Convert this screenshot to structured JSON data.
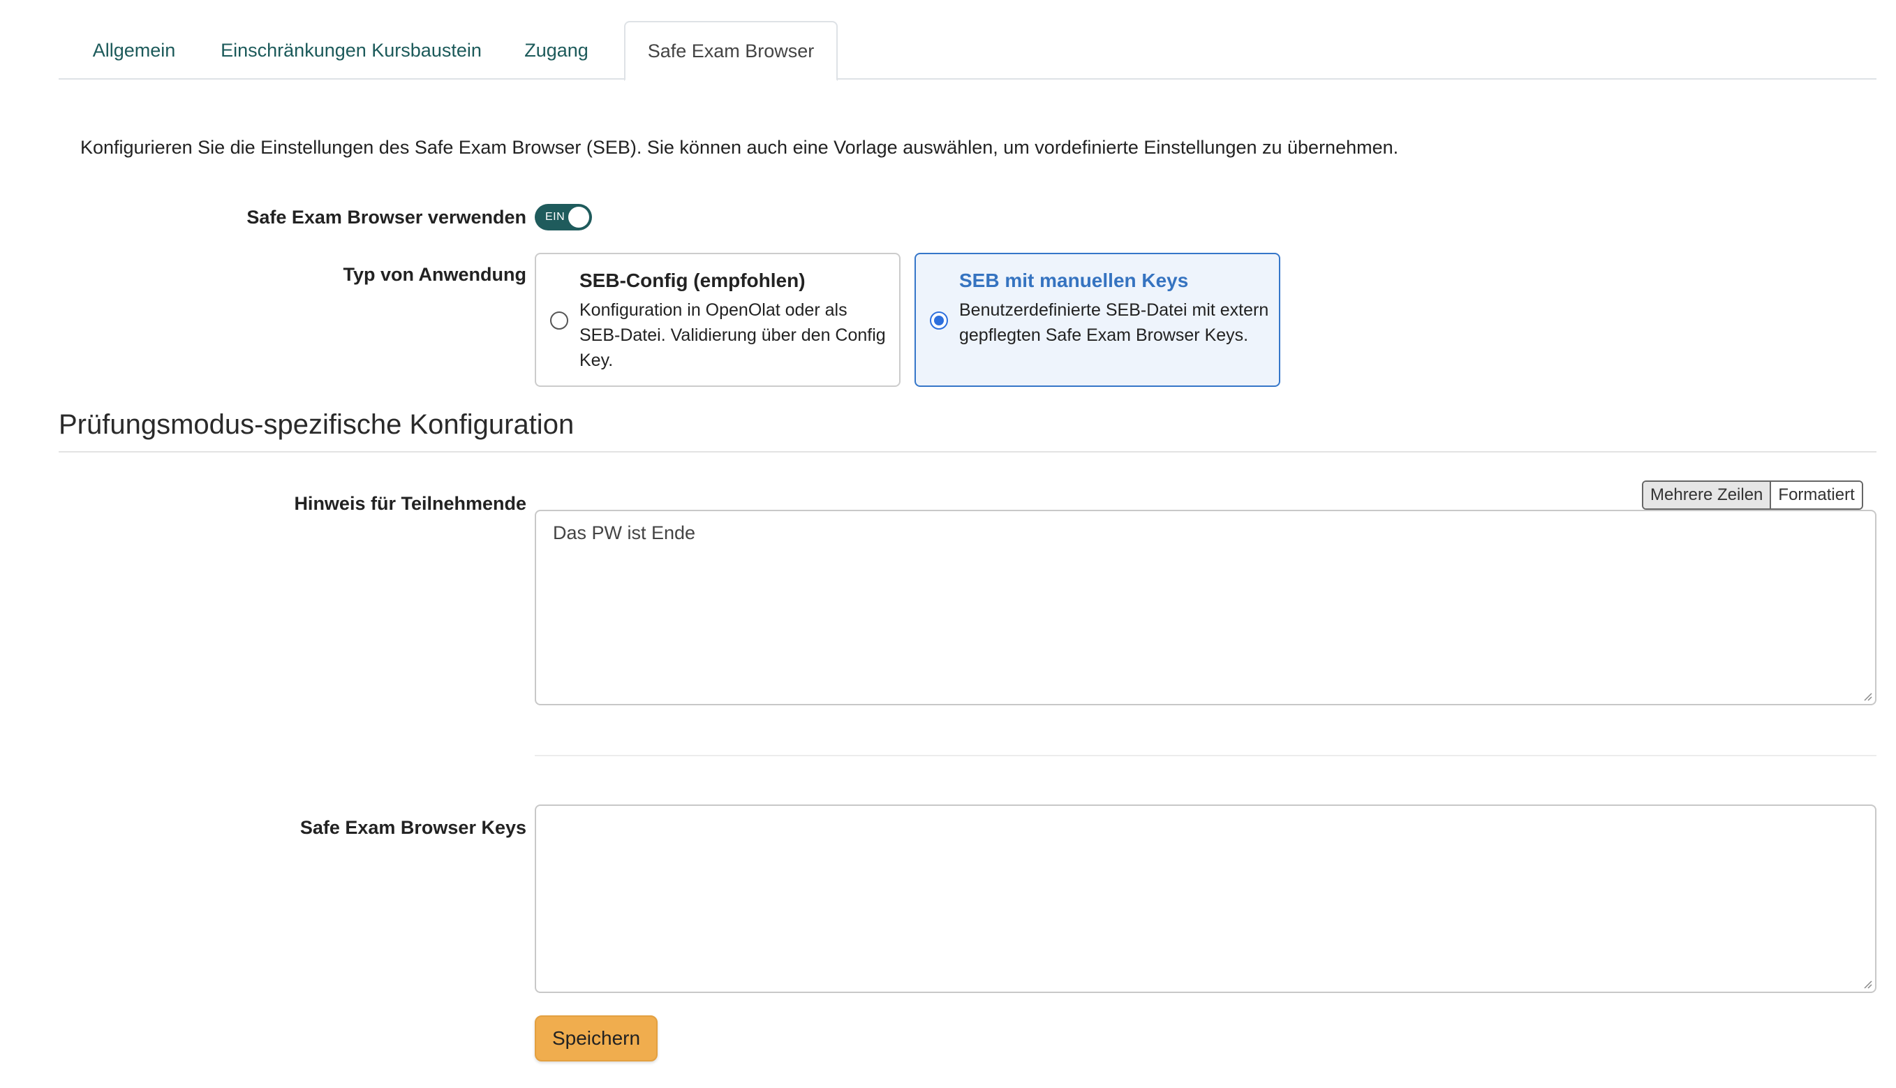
{
  "tabs": [
    {
      "label": "Allgemein",
      "active": false
    },
    {
      "label": "Einschränkungen Kursbaustein",
      "active": false
    },
    {
      "label": "Zugang",
      "active": false
    },
    {
      "label": "Safe Exam Browser",
      "active": true
    }
  ],
  "intro": "Konfigurieren Sie die Einstellungen des Safe Exam Browser (SEB). Sie können auch eine Vorlage auswählen, um vordefinierte Einstellungen zu übernehmen.",
  "use_seb": {
    "label": "Safe Exam Browser verwenden",
    "toggle_text": "EIN",
    "enabled": true
  },
  "app_type": {
    "label": "Typ von Anwendung",
    "options": [
      {
        "title": "SEB-Config (empfohlen)",
        "description": "Konfiguration in OpenOlat oder als SEB-Datei. Validierung über den Config Key.",
        "selected": false
      },
      {
        "title": "SEB mit manuellen Keys",
        "description": "Benutzerdefinierte SEB-Datei mit extern gepflegten Safe Exam Browser Keys.",
        "selected": true
      }
    ]
  },
  "section_title": "Prüfungsmodus-spezifische Konfiguration",
  "hint": {
    "label": "Hinweis für Teilnehmende",
    "value": "Das PW ist Ende",
    "modes": [
      {
        "label": "Mehrere Zeilen",
        "active": true
      },
      {
        "label": "Formatiert",
        "active": false
      }
    ]
  },
  "keys": {
    "label": "Safe Exam Browser Keys",
    "value": ""
  },
  "save_label": "Speichern",
  "colors": {
    "tab_link": "#1c5a5a",
    "toggle_on": "#1f5b5c",
    "selected_border": "#3576c9",
    "selected_bg": "#eef4fc",
    "save_button": "#f0ad4e"
  }
}
